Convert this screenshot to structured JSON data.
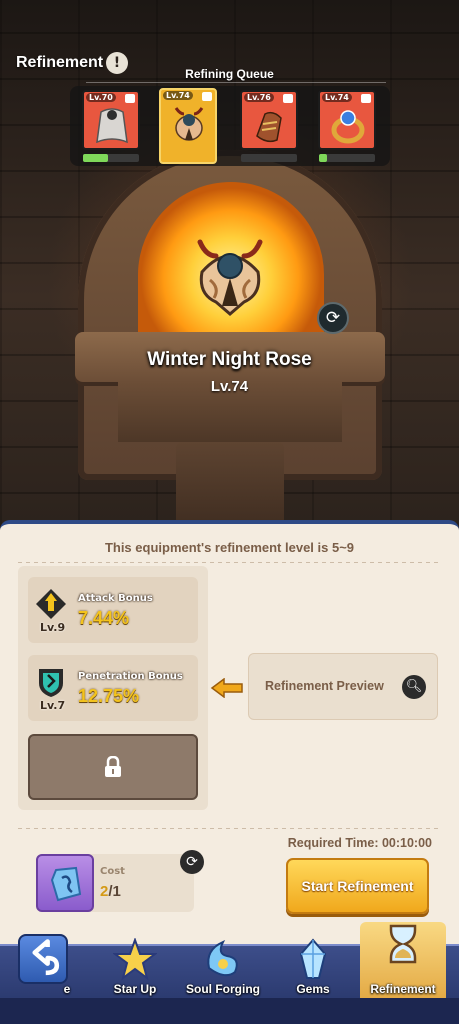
{
  "header": {
    "title": "Refinement",
    "info_glyph": "!"
  },
  "queue": {
    "label": "Refining Queue",
    "slots": [
      {
        "level": "Lv.70",
        "progress": 0.45,
        "selected": false,
        "icon": "cloak-icon"
      },
      {
        "level": "Lv.74",
        "progress": 0.0,
        "selected": true,
        "icon": "horned-mask-icon"
      },
      {
        "level": "Lv.76",
        "progress": 0.0,
        "selected": false,
        "icon": "gauntlet-icon"
      },
      {
        "level": "Lv.74",
        "progress": 0.15,
        "selected": false,
        "icon": "ring-icon"
      }
    ]
  },
  "item": {
    "name": "Winter Night Rose",
    "level": "Lv.74"
  },
  "panel": {
    "header": "This equipment's refinement level is 5~9",
    "stats": [
      {
        "name": "Attack Bonus",
        "value": "7.44%",
        "level": "Lv.9",
        "color": "#f3c31d"
      },
      {
        "name": "Penetration Bonus",
        "value": "12.75%",
        "level": "Lv.7",
        "color": "#2fc1b0"
      }
    ],
    "preview_label": "Refinement Preview",
    "required_time": "Required Time: 00:10:00",
    "cost_label": "Cost",
    "cost_have": "2",
    "cost_need": "/1",
    "start_label": "Start Refinement"
  },
  "nav": {
    "tabs": [
      {
        "label": "e",
        "active": false
      },
      {
        "label": "Star Up",
        "active": false
      },
      {
        "label": "Soul Forging",
        "active": false
      },
      {
        "label": "Gems",
        "active": false
      },
      {
        "label": "Refinement",
        "active": true
      }
    ]
  }
}
